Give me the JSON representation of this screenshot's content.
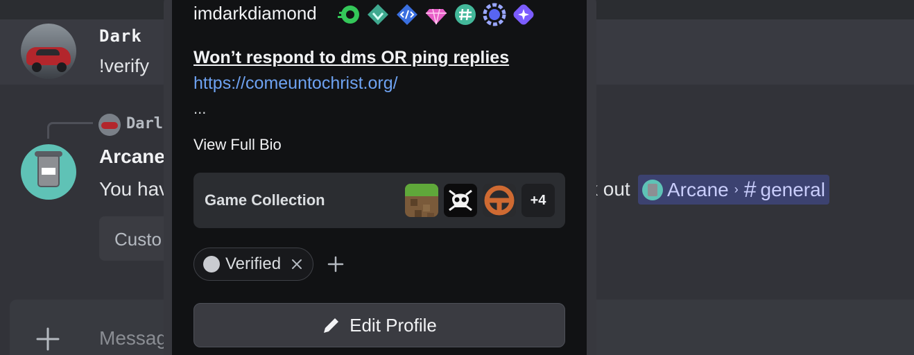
{
  "chat": {
    "messages": [
      {
        "author": "Dark",
        "text": "!verify"
      },
      {
        "reply_to": "Darl",
        "author": "Arcane",
        "text_prefix": "You hav",
        "text_suffix": "k out",
        "mention": {
          "server": "Arcane",
          "channel": "general"
        },
        "button_label": "Custo"
      }
    ],
    "composer_placeholder": "Messag"
  },
  "profile_popout": {
    "username": "imdarkdiamond",
    "badges": [
      "nitro-boost-badge",
      "moderator-programs-badge",
      "active-developer-badge",
      "nitro-gem-badge",
      "hashtag-badge",
      "quest-badge",
      "hypesquad-badge"
    ],
    "bio_title": "Won’t respond to dms OR ping replies",
    "bio_link": "https://comeuntochrist.org/",
    "bio_ellipsis": "...",
    "view_full_bio": "View Full Bio",
    "game_collection": {
      "label": "Game Collection",
      "games": [
        "minecraft-icon",
        "sea-of-thieves-icon",
        "team-fortress-icon"
      ],
      "more_count": "+4"
    },
    "roles": [
      {
        "name": "Verified",
        "color": "#c9cbd0"
      }
    ],
    "edit_profile_label": "Edit Profile"
  },
  "colors": {
    "background": "#323339",
    "popout": "#111214",
    "mention_bg": "#3c4270",
    "link": "#6ea2f1"
  }
}
